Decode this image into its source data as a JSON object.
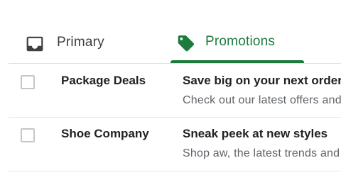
{
  "tabs": {
    "primary": {
      "label": "Primary",
      "icon": "inbox-icon",
      "color": "#3c4043"
    },
    "promotions": {
      "label": "Promotions",
      "icon": "tag-icon",
      "color": "#1e7b3e",
      "selected": true
    }
  },
  "emails": [
    {
      "sender": "Package Deals",
      "subject": "Save big on your next order",
      "snippet": "Check out our latest offers and"
    },
    {
      "sender": "Shoe Company",
      "subject": "Sneak peek at new styles",
      "snippet": "Shop aw, the latest trends and"
    }
  ]
}
